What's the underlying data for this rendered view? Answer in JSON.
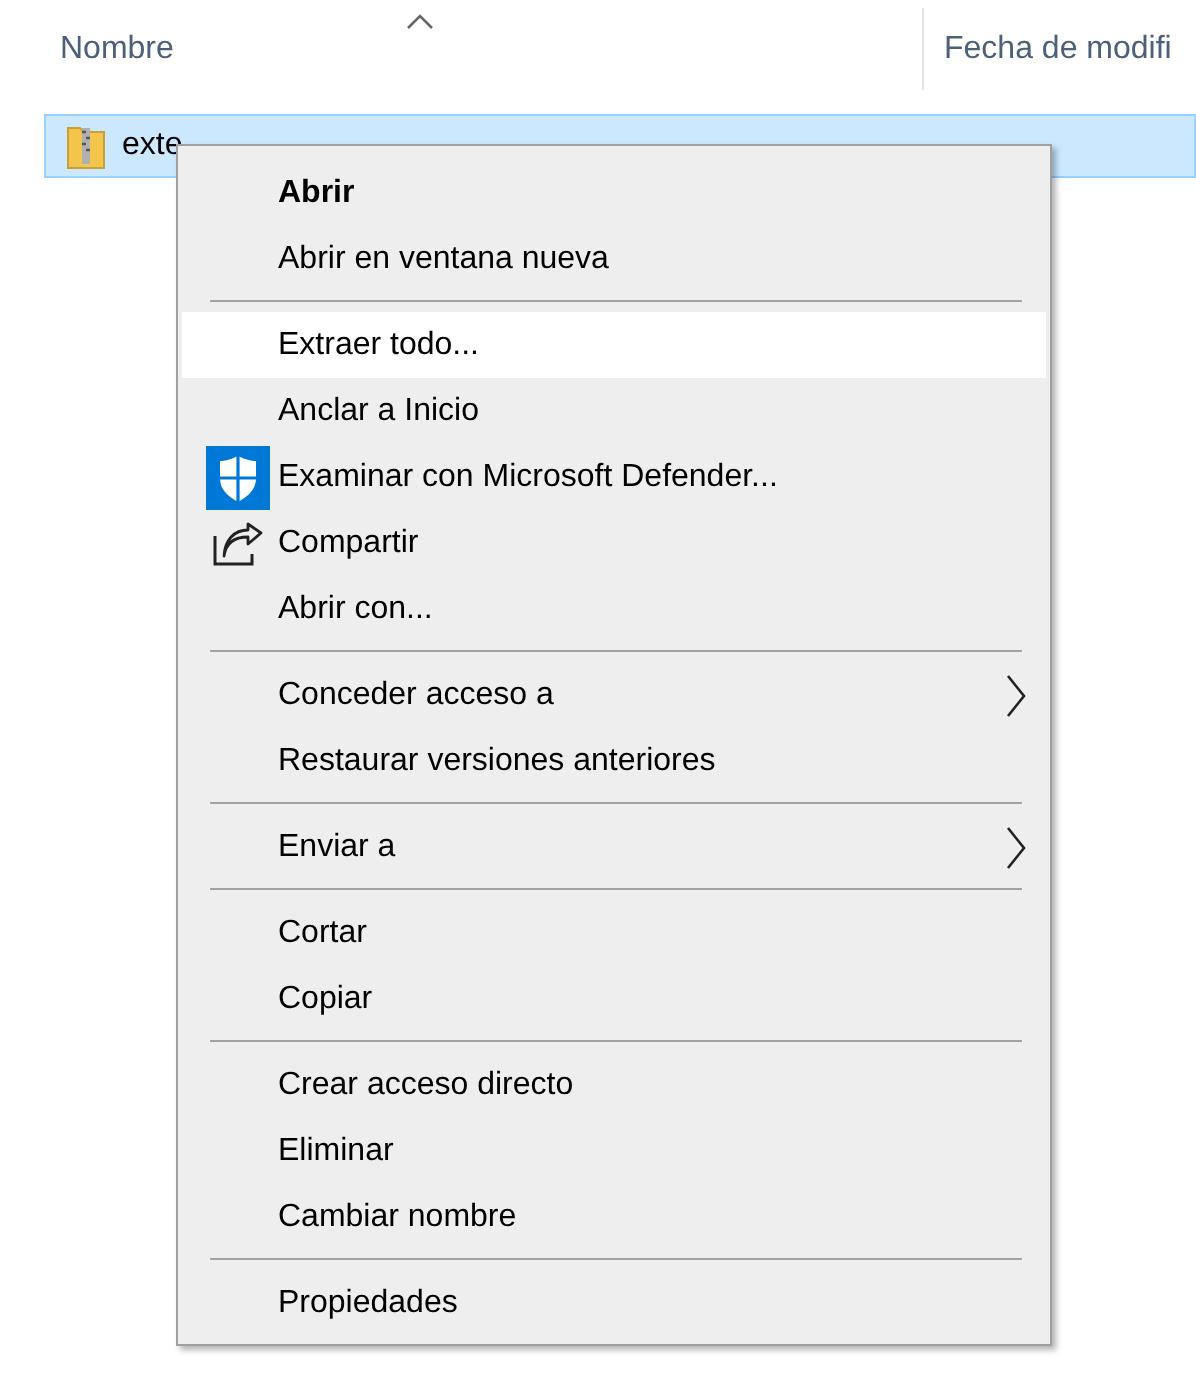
{
  "columns": [
    {
      "label": "Nombre",
      "sorted": true
    },
    {
      "label": "Fecha de modifi",
      "sorted": false
    }
  ],
  "file": {
    "name": "exte",
    "selected": true
  },
  "menu": {
    "groups": [
      [
        {
          "label": "Abrir",
          "bold": true,
          "selected": false,
          "submenu": false
        },
        {
          "label": "Abrir en ventana nueva",
          "bold": false,
          "selected": false,
          "submenu": false
        }
      ],
      [
        {
          "label": "Extraer todo...",
          "bold": false,
          "selected": true,
          "submenu": false
        },
        {
          "label": "Anclar a Inicio",
          "bold": false,
          "selected": false,
          "submenu": false
        },
        {
          "label": "Examinar con Microsoft Defender...",
          "bold": false,
          "selected": false,
          "submenu": false,
          "kind": "shield"
        },
        {
          "label": "Compartir",
          "bold": false,
          "selected": false,
          "submenu": false,
          "kind": "share"
        },
        {
          "label": "Abrir con...",
          "bold": false,
          "selected": false,
          "submenu": false
        }
      ],
      [
        {
          "label": "Conceder acceso a",
          "bold": false,
          "selected": false,
          "submenu": true
        },
        {
          "label": "Restaurar versiones anteriores",
          "bold": false,
          "selected": false,
          "submenu": false
        }
      ],
      [
        {
          "label": "Enviar a",
          "bold": false,
          "selected": false,
          "submenu": true
        }
      ],
      [
        {
          "label": "Cortar",
          "bold": false,
          "selected": false,
          "submenu": false
        },
        {
          "label": "Copiar",
          "bold": false,
          "selected": false,
          "submenu": false
        }
      ],
      [
        {
          "label": "Crear acceso directo",
          "bold": false,
          "selected": false,
          "submenu": false
        },
        {
          "label": "Eliminar",
          "bold": false,
          "selected": false,
          "submenu": false
        },
        {
          "label": "Cambiar nombre",
          "bold": false,
          "selected": false,
          "submenu": false
        }
      ],
      [
        {
          "label": "Propiedades",
          "bold": false,
          "selected": false,
          "submenu": false
        }
      ]
    ]
  }
}
